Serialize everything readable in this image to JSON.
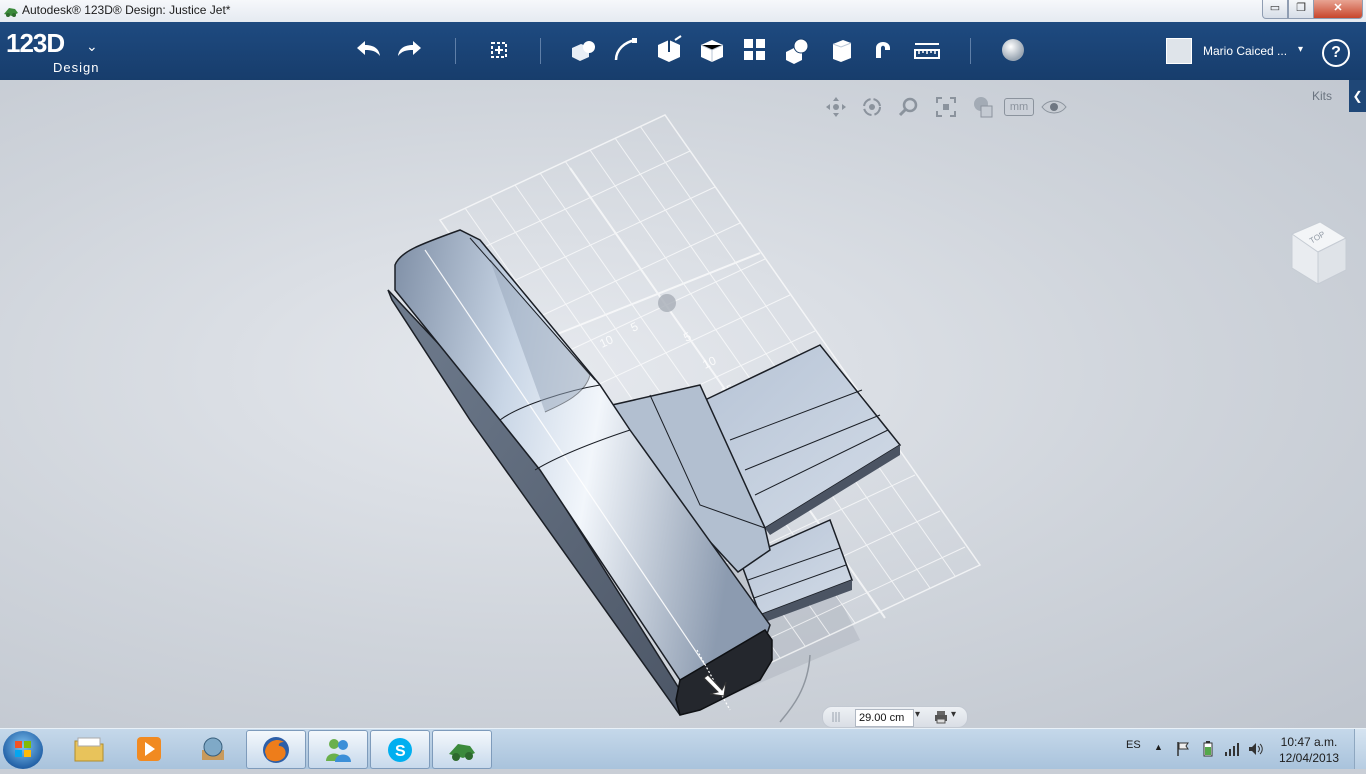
{
  "window": {
    "title": "Autodesk® 123D® Design: Justice Jet*",
    "minimize": "▭",
    "maximize": "❐",
    "close": "✕"
  },
  "app": {
    "logo_main": "123D",
    "logo_sub": "Design",
    "logo_caret": "⌄"
  },
  "toolbar": {
    "tools": [
      "undo-icon",
      "redo-icon",
      "transform-icon",
      "primitives-icon",
      "sketch-icon",
      "construct-icon",
      "modify-icon",
      "pattern-icon",
      "group-icon",
      "combine-icon",
      "measure-icon",
      "snap-icon",
      "ruler-icon",
      "material-icon"
    ]
  },
  "user": {
    "name": "Mario Caiced ...",
    "caret": "▾"
  },
  "help": {
    "label": "?"
  },
  "viewport": {
    "nav_icons": [
      "pan-icon",
      "orbit-icon",
      "zoom-icon",
      "fit-icon",
      "view-mode-icon"
    ],
    "units": "mm",
    "kits_label": "Kits",
    "kits_arrow": "❮",
    "viewcube_label": "TOP",
    "grid_labels": [
      "10",
      "5",
      "5",
      "10",
      "15"
    ],
    "dimension_value": "29.00 cm",
    "dimension_caret": "▾"
  },
  "taskbar": {
    "pinned": [
      "explorer-icon",
      "media-player-icon",
      "sphere-app-icon",
      "firefox-icon",
      "messenger-icon",
      "skype-icon",
      "123d-app-icon"
    ],
    "language": "ES",
    "tray_arrow": "▲",
    "time": "10:47 a.m.",
    "date": "12/04/2013"
  },
  "colors": {
    "toolbar": "#1a4272",
    "viewport_bg": "#d3d7dd",
    "model_light": "#c7d3e3",
    "model_dark": "#2a2d33"
  }
}
